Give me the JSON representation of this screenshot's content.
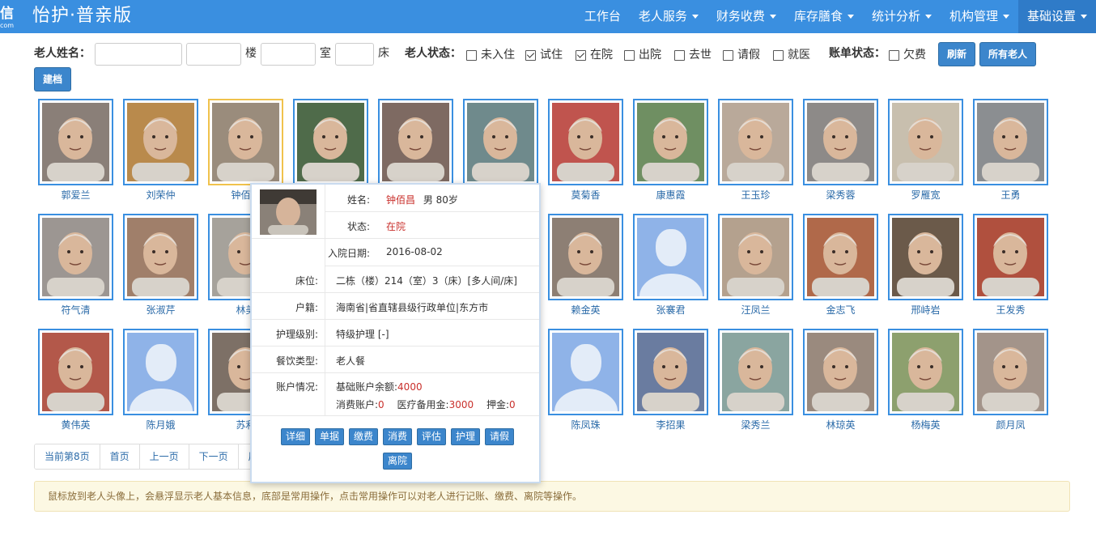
{
  "app": {
    "logo_glyph": "信",
    "logo_sub": "com",
    "title": "怡护·普亲版"
  },
  "nav": [
    {
      "label": "工作台",
      "has_caret": false
    },
    {
      "label": "老人服务",
      "has_caret": true
    },
    {
      "label": "财务收费",
      "has_caret": true
    },
    {
      "label": "库存膳食",
      "has_caret": true
    },
    {
      "label": "统计分析",
      "has_caret": true
    },
    {
      "label": "机构管理",
      "has_caret": true
    },
    {
      "label": "基础设置",
      "has_caret": true,
      "active": true
    }
  ],
  "filter": {
    "name_label": "老人姓名：",
    "name_value": "",
    "building_value": "",
    "building_unit": "楼",
    "room_value": "",
    "room_unit": "室",
    "bed_value": "",
    "bed_unit": "床",
    "status_label": "老人状态：",
    "statuses": [
      {
        "label": "未入住",
        "checked": false
      },
      {
        "label": "试住",
        "checked": true
      },
      {
        "label": "在院",
        "checked": true
      },
      {
        "label": "出院",
        "checked": false
      },
      {
        "label": "去世",
        "checked": false
      },
      {
        "label": "请假",
        "checked": false
      },
      {
        "label": "就医",
        "checked": false
      }
    ],
    "bill_label": "账单状态：",
    "bill_option": {
      "label": "欠费",
      "checked": false
    },
    "refresh_button": "刷新",
    "all_button": "所有老人",
    "create_button": "建档"
  },
  "residents": [
    {
      "name": "郭爱兰",
      "photo": true,
      "hue": "#8a7f78"
    },
    {
      "name": "刘荣仲",
      "photo": true,
      "hue": "#b98a4c"
    },
    {
      "name": "钟佰昌",
      "photo": true,
      "hue": "#9a8c7c",
      "active": true
    },
    {
      "name": "",
      "photo": true,
      "hue": "#4f6b4a"
    },
    {
      "name": "",
      "photo": true,
      "hue": "#7e6a62"
    },
    {
      "name": "",
      "photo": true,
      "hue": "#6f8a8c"
    },
    {
      "name": "莫菊香",
      "photo": true,
      "hue": "#c0544e"
    },
    {
      "name": "康惠霞",
      "photo": true,
      "hue": "#6f8f62"
    },
    {
      "name": "王玉珍",
      "photo": true,
      "hue": "#b9a99a"
    },
    {
      "name": "梁秀蓉",
      "photo": true,
      "hue": "#8d8a88"
    },
    {
      "name": "罗雁宽",
      "photo": true,
      "hue": "#c8bfae"
    },
    {
      "name": "王勇",
      "photo": true,
      "hue": "#8b8e91"
    },
    {
      "name": "符气清",
      "photo": true,
      "hue": "#9c9692"
    },
    {
      "name": "张淑芹",
      "photo": true,
      "hue": "#a07f6a"
    },
    {
      "name": "林美",
      "photo": true,
      "hue": "#a6a29b"
    },
    {
      "name": "",
      "photo": true,
      "hue": "#7e7b76"
    },
    {
      "name": "",
      "photo": true,
      "hue": "#8f8178"
    },
    {
      "name": "",
      "photo": true,
      "hue": "#8b837e"
    },
    {
      "name": "赖金英",
      "photo": true,
      "hue": "#8d7f74"
    },
    {
      "name": "张褰君",
      "photo": false
    },
    {
      "name": "汪凤兰",
      "photo": true,
      "hue": "#b4a18e"
    },
    {
      "name": "金志飞",
      "photo": true,
      "hue": "#b0694a"
    },
    {
      "name": "邢峙岩",
      "photo": true,
      "hue": "#6b5a4a"
    },
    {
      "name": "王发秀",
      "photo": true,
      "hue": "#b0503e"
    },
    {
      "name": "黄伟英",
      "photo": true,
      "hue": "#b3584a"
    },
    {
      "name": "陈月娥",
      "photo": false
    },
    {
      "name": "苏利",
      "photo": true,
      "hue": "#7d7066"
    },
    {
      "name": "",
      "photo": true,
      "hue": "#8f8178"
    },
    {
      "name": "",
      "photo": true,
      "hue": "#8f8178"
    },
    {
      "name": "",
      "photo": true,
      "hue": "#8f8178"
    },
    {
      "name": "陈凤珠",
      "photo": false
    },
    {
      "name": "李招果",
      "photo": true,
      "hue": "#6a7ca0"
    },
    {
      "name": "梁秀兰",
      "photo": true,
      "hue": "#8aa5a0"
    },
    {
      "name": "林琼英",
      "photo": true,
      "hue": "#9a8a7e"
    },
    {
      "name": "杨梅英",
      "photo": true,
      "hue": "#8da06e"
    },
    {
      "name": "颜月凤",
      "photo": true,
      "hue": "#a3948a"
    }
  ],
  "pagination": [
    "当前第8页",
    "首页",
    "上一页",
    "下一页",
    "尾"
  ],
  "notice": "鼠标放到老人头像上，会悬浮显示老人基本信息，底部是常用操作，点击常用操作可以对老人进行记账、缴费、离院等操作。",
  "popup": {
    "name_label": "姓名:",
    "name": "钟佰昌",
    "gender_age": "男 80岁",
    "status_label": "状态:",
    "status": "在院",
    "admit_label": "入院日期:",
    "admit_date": "2016-08-02",
    "bed_label": "床位:",
    "bed": "二栋（楼）214（室）3（床）[多人间/床]",
    "origin_label": "户籍:",
    "origin": "海南省|省直辖县级行政单位|东方市",
    "care_label": "护理级别:",
    "care": "特级护理  [-]",
    "meal_label": "餐饮类型:",
    "meal": "老人餐",
    "account_label": "账户情况:",
    "base_balance_label": "基础账户余额:",
    "base_balance": "4000",
    "consume_label": "消费账户:",
    "consume": "0",
    "medical_label": "医疗备用金:",
    "medical": "3000",
    "deposit_label": "押金:",
    "deposit": "0",
    "actions": [
      "详细",
      "单据",
      "缴费",
      "消费",
      "评估",
      "护理",
      "请假",
      "离院"
    ]
  }
}
